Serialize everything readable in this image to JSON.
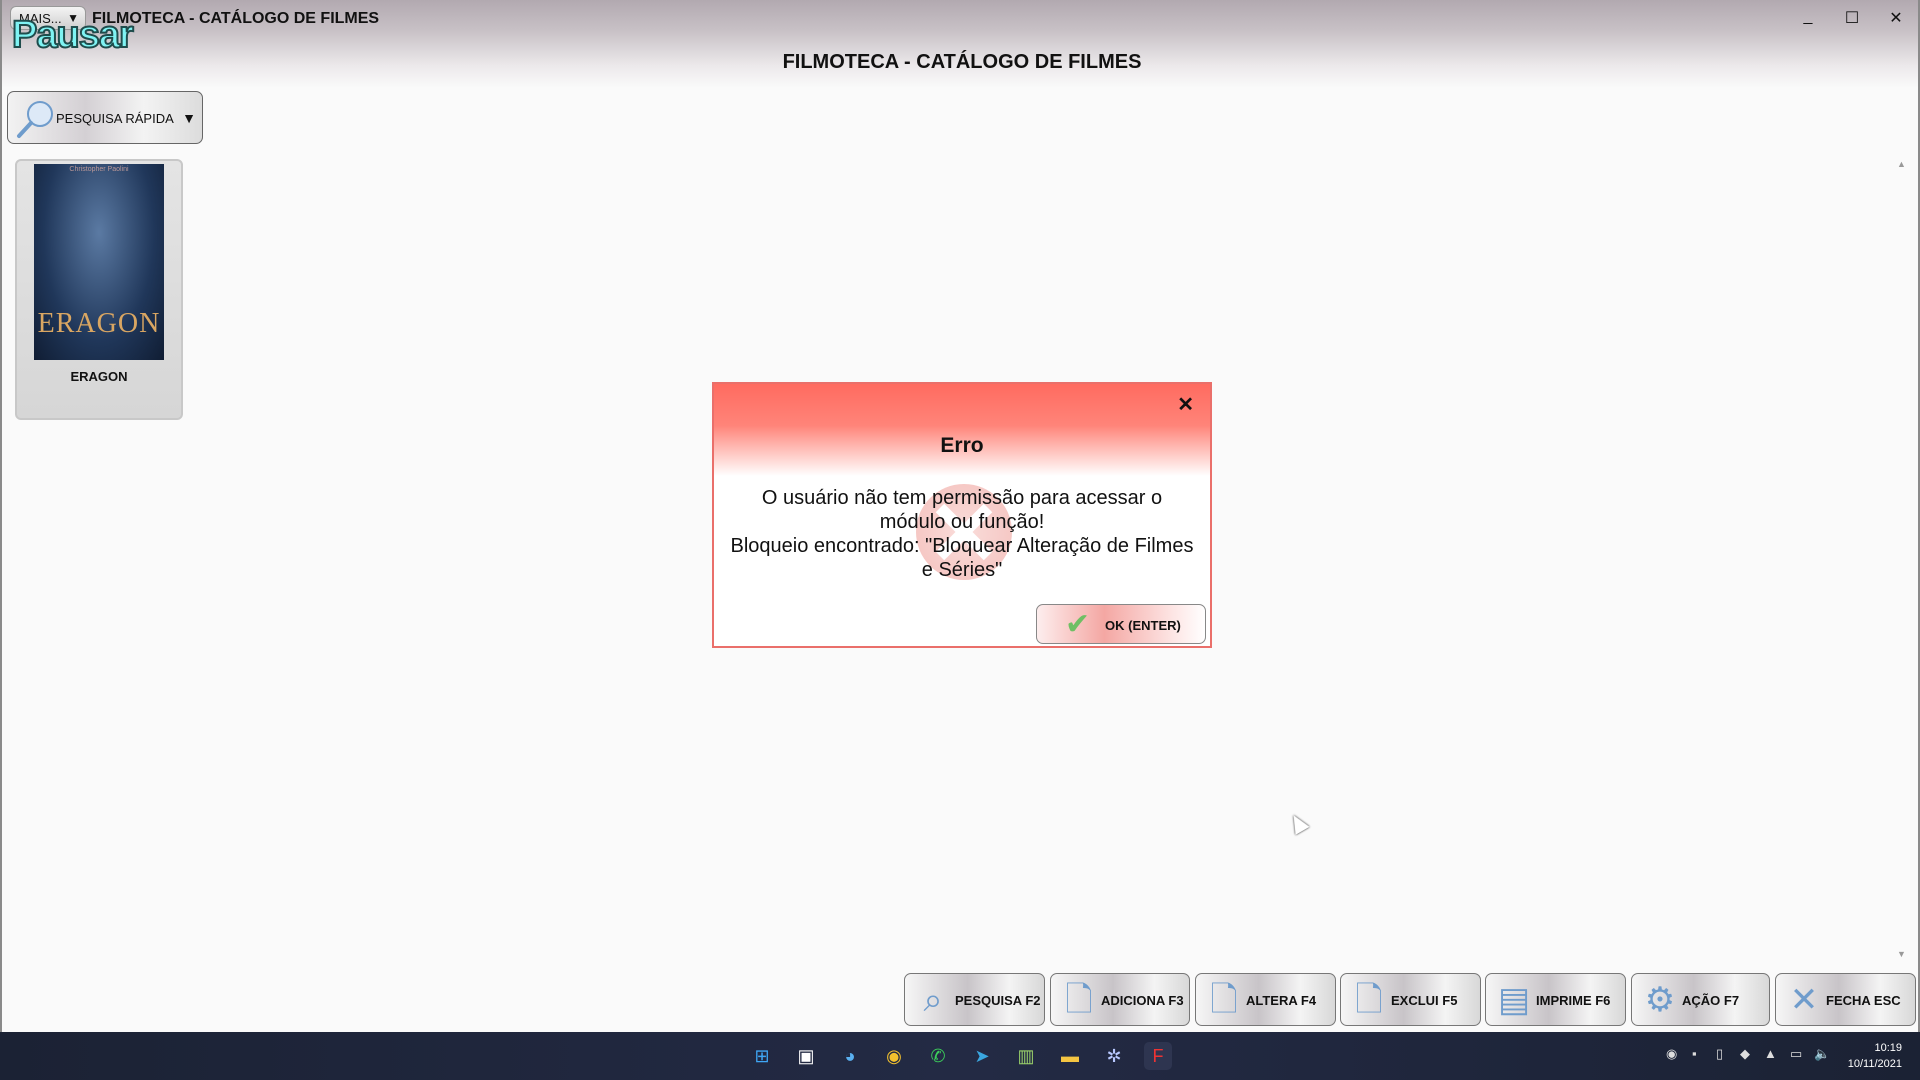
{
  "window": {
    "title": "FILMOTECA - CATÁLOGO DE FILMES",
    "mais_label": "MAIS...",
    "overlay_label": "Pausar",
    "minimize": "_",
    "maximize": "☐",
    "close": "✕"
  },
  "header": {
    "title": "FILMOTECA - CATÁLOGO DE FILMES"
  },
  "quick_search": {
    "label": "PESQUISA RÁPIDA"
  },
  "movies": [
    {
      "title": "ERAGON",
      "cover_title": "ERAGON",
      "cover_author": "Christopher Paolini"
    }
  ],
  "dialog": {
    "title": "Erro",
    "close": "✕",
    "message_lines": [
      "O usuário não tem permissão para acessar o",
      "módulo ou função!",
      "Bloqueio encontrado: \"Bloquear Alteração de Filmes",
      "e Séries\""
    ],
    "ok_label": "OK (ENTER)"
  },
  "toolbar": [
    {
      "label": "PESQUISA F2",
      "icon": "search-icon"
    },
    {
      "label": "ADICIONA F3",
      "icon": "add-document-icon"
    },
    {
      "label": "ALTERA F4",
      "icon": "edit-document-icon"
    },
    {
      "label": "EXCLUI F5",
      "icon": "delete-document-icon"
    },
    {
      "label": "IMPRIME F6",
      "icon": "printer-icon"
    },
    {
      "label": "AÇÃO F7",
      "icon": "gears-icon"
    },
    {
      "label": "FECHA ESC",
      "icon": "close-icon"
    }
  ],
  "taskbar": {
    "time": "10:19",
    "date": "10/11/2021"
  },
  "colors": {
    "dialog_header": "#ff6b60",
    "dialog_border": "#ea6f6a",
    "taskbar": "#1b2234"
  }
}
